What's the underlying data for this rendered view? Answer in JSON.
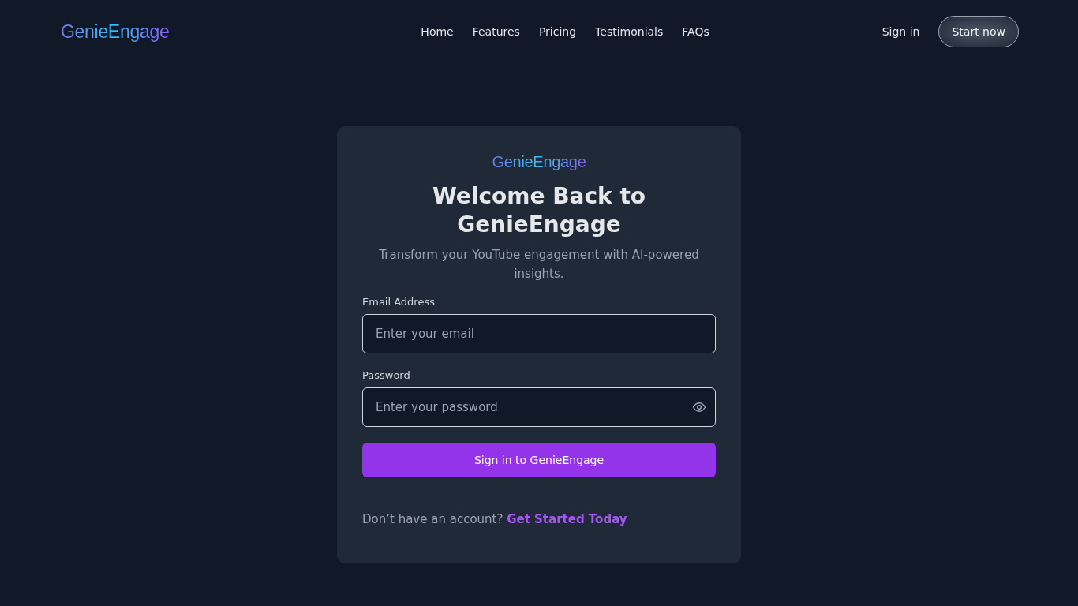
{
  "header": {
    "logo": "GenieEngage",
    "nav": [
      {
        "label": "Home"
      },
      {
        "label": "Features"
      },
      {
        "label": "Pricing"
      },
      {
        "label": "Testimonials"
      },
      {
        "label": "FAQs"
      }
    ],
    "sign_in": "Sign in",
    "start_button": "Start now"
  },
  "card": {
    "logo": "GenieEngage",
    "title": "Welcome Back to GenieEngage",
    "subtitle": "Transform your YouTube engagement with AI-powered insights.",
    "fields": [
      {
        "label": "Email Address",
        "placeholder": "Enter your email",
        "kind": "text"
      },
      {
        "label": "Password",
        "placeholder": "Enter your password",
        "kind": "password"
      }
    ],
    "submit": "Sign in to GenieEngage",
    "footer_text": "Don’t have an account?",
    "footer_link": "Get Started Today"
  }
}
